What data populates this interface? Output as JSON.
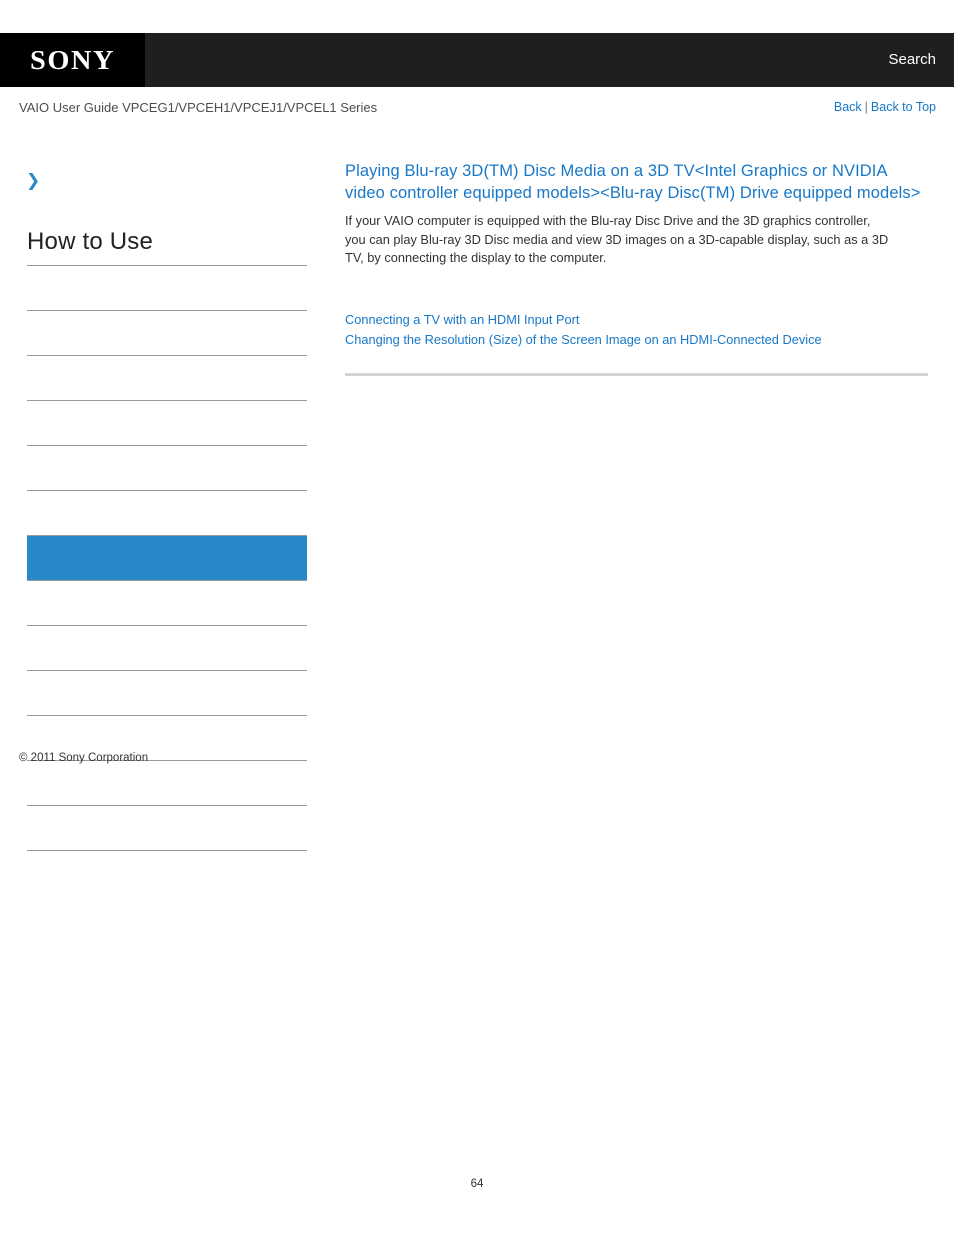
{
  "header": {
    "logo_text": "SONY",
    "search_label": "Search",
    "logo_bg": "#000000",
    "bar_bg": "#1f1f1f"
  },
  "subbar": {
    "guide_title": "VAIO User Guide VPCEG1/VPCEH1/VPCEJ1/VPCEL1 Series",
    "back_label": "Back",
    "separator": "|",
    "back_to_top_label": "Back to Top",
    "link_color": "#1878c8"
  },
  "sidebar": {
    "breadcrumb_icon": "chevron-right-icon",
    "nav_title": "How to Use",
    "selected_index": 6,
    "accent_color": "#2889c8",
    "items": [
      {
        "label": ""
      },
      {
        "label": ""
      },
      {
        "label": ""
      },
      {
        "label": ""
      },
      {
        "label": ""
      },
      {
        "label": ""
      },
      {
        "label": ""
      },
      {
        "label": ""
      },
      {
        "label": ""
      },
      {
        "label": ""
      },
      {
        "label": ""
      },
      {
        "label": ""
      },
      {
        "label": ""
      }
    ],
    "copyright": "© 2011 Sony Corporation"
  },
  "main": {
    "title": "Playing Blu-ray 3D(TM) Disc Media on a 3D TV<Intel Graphics or NVIDIA video controller equipped models><Blu-ray Disc(TM) Drive equipped models>",
    "body": "If your VAIO computer is equipped with the Blu-ray Disc Drive and the 3D graphics controller, you can play Blu-ray 3D Disc media and view 3D images on a 3D-capable display, such as a 3D TV, by connecting the display to the computer.",
    "related_links": [
      "Connecting a TV with an HDMI Input Port",
      "Changing the Resolution (Size) of the Screen Image on an HDMI-Connected Device"
    ]
  },
  "footer": {
    "page_number": "64"
  }
}
